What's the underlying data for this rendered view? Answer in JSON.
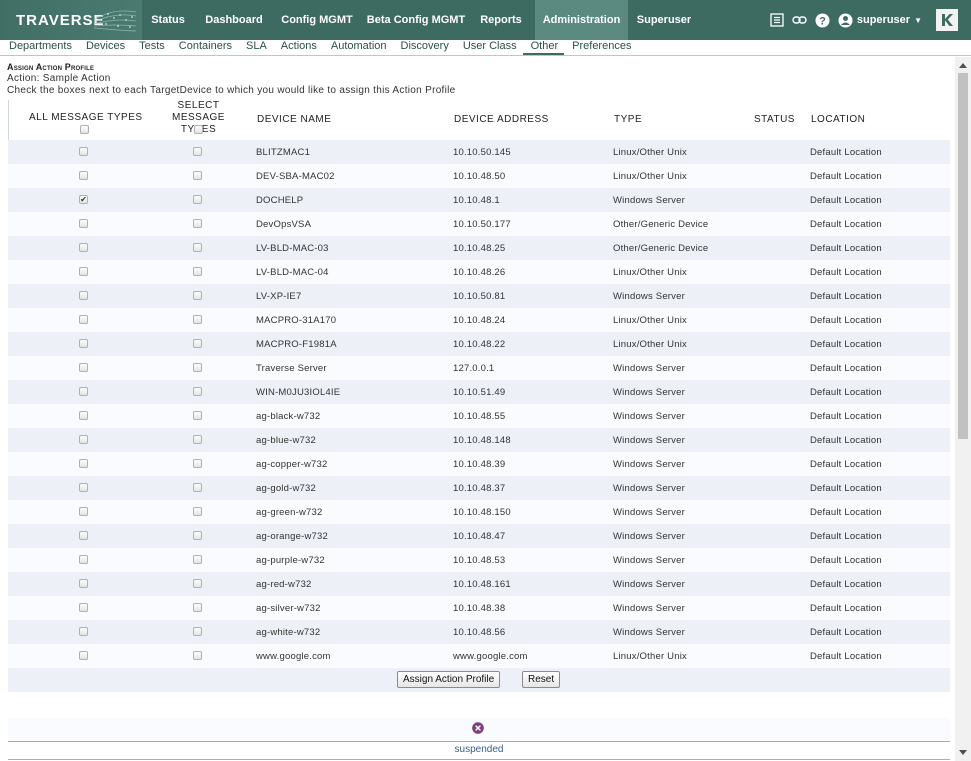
{
  "app": {
    "logo_text": "TRAVERSE"
  },
  "nav": {
    "items": [
      {
        "label": "Status",
        "width": 0
      },
      {
        "label": "Dashboard"
      },
      {
        "label": "Config MGMT"
      },
      {
        "label": "Beta Config MGMT"
      },
      {
        "label": "Reports"
      },
      {
        "label": "Administration",
        "active": true
      },
      {
        "label": "Superuser"
      }
    ],
    "user": "superuser"
  },
  "subnav": {
    "items": [
      "Departments",
      "Devices",
      "Tests",
      "Containers",
      "SLA",
      "Actions",
      "Automation",
      "Discovery",
      "User Class",
      "Other",
      "Preferences"
    ],
    "active": "Other"
  },
  "page": {
    "heading": "Assign Action Profile",
    "action_line": "Action: Sample Action",
    "instruction": "Check the boxes next to each TargetDevice to which you would like to assign this Action Profile"
  },
  "table": {
    "headers": {
      "all_types": "ALL MESSAGE TYPES",
      "select_types_1": "SELECT MESSAGE",
      "select_types_2": "TYPES",
      "device_name": "DEVICE NAME",
      "device_address": "DEVICE ADDRESS",
      "type": "TYPE",
      "status": "STATUS",
      "location": "LOCATION"
    },
    "rows": [
      {
        "name": "BLITZMAC1",
        "address": "10.10.50.145",
        "type": "Linux/Other Unix",
        "location": "Default Location",
        "checked": false
      },
      {
        "name": "DEV-SBA-MAC02",
        "address": "10.10.48.50",
        "type": "Linux/Other Unix",
        "location": "Default Location",
        "checked": false
      },
      {
        "name": "DOCHELP",
        "address": "10.10.48.1",
        "type": "Windows Server",
        "location": "Default Location",
        "checked": true
      },
      {
        "name": "DevOpsVSA",
        "address": "10.10.50.177",
        "type": "Other/Generic Device",
        "location": "Default Location",
        "checked": false
      },
      {
        "name": "LV-BLD-MAC-03",
        "address": "10.10.48.25",
        "type": "Other/Generic Device",
        "location": "Default Location",
        "checked": false
      },
      {
        "name": "LV-BLD-MAC-04",
        "address": "10.10.48.26",
        "type": "Linux/Other Unix",
        "location": "Default Location",
        "checked": false
      },
      {
        "name": "LV-XP-IE7",
        "address": "10.10.50.81",
        "type": "Windows Server",
        "location": "Default Location",
        "checked": false
      },
      {
        "name": "MACPRO-31A170",
        "address": "10.10.48.24",
        "type": "Linux/Other Unix",
        "location": "Default Location",
        "checked": false
      },
      {
        "name": "MACPRO-F1981A",
        "address": "10.10.48.22",
        "type": "Linux/Other Unix",
        "location": "Default Location",
        "checked": false
      },
      {
        "name": "Traverse Server",
        "address": "127.0.0.1",
        "type": "Windows Server",
        "location": "Default Location",
        "checked": false
      },
      {
        "name": "WIN-M0JU3IOL4IE",
        "address": "10.10.51.49",
        "type": "Windows Server",
        "location": "Default Location",
        "checked": false
      },
      {
        "name": "ag-black-w732",
        "address": "10.10.48.55",
        "type": "Windows Server",
        "location": "Default Location",
        "checked": false
      },
      {
        "name": "ag-blue-w732",
        "address": "10.10.48.148",
        "type": "Windows Server",
        "location": "Default Location",
        "checked": false
      },
      {
        "name": "ag-copper-w732",
        "address": "10.10.48.39",
        "type": "Windows Server",
        "location": "Default Location",
        "checked": false
      },
      {
        "name": "ag-gold-w732",
        "address": "10.10.48.37",
        "type": "Windows Server",
        "location": "Default Location",
        "checked": false
      },
      {
        "name": "ag-green-w732",
        "address": "10.10.48.150",
        "type": "Windows Server",
        "location": "Default Location",
        "checked": false
      },
      {
        "name": "ag-orange-w732",
        "address": "10.10.48.47",
        "type": "Windows Server",
        "location": "Default Location",
        "checked": false
      },
      {
        "name": "ag-purple-w732",
        "address": "10.10.48.53",
        "type": "Windows Server",
        "location": "Default Location",
        "checked": false
      },
      {
        "name": "ag-red-w732",
        "address": "10.10.48.161",
        "type": "Windows Server",
        "location": "Default Location",
        "checked": false
      },
      {
        "name": "ag-silver-w732",
        "address": "10.10.48.38",
        "type": "Windows Server",
        "location": "Default Location",
        "checked": false
      },
      {
        "name": "ag-white-w732",
        "address": "10.10.48.56",
        "type": "Windows Server",
        "location": "Default Location",
        "checked": false
      },
      {
        "name": "www.google.com",
        "address": "www.google.com",
        "type": "Linux/Other Unix",
        "location": "Default Location",
        "checked": false
      }
    ]
  },
  "buttons": {
    "assign": "Assign Action Profile",
    "reset": "Reset"
  },
  "footer": {
    "status": "suspended"
  },
  "icons": {
    "list": "list-icon",
    "link": "link-icon",
    "help": "help-icon",
    "user": "user-icon",
    "brand": "kaseya-k-icon",
    "close": "close-circle-icon"
  },
  "colors": {
    "topbar": "#3d6b62",
    "active_tab": "#5a8a80",
    "row_odd": "#eef0f7",
    "close": "#7b3f7f"
  }
}
